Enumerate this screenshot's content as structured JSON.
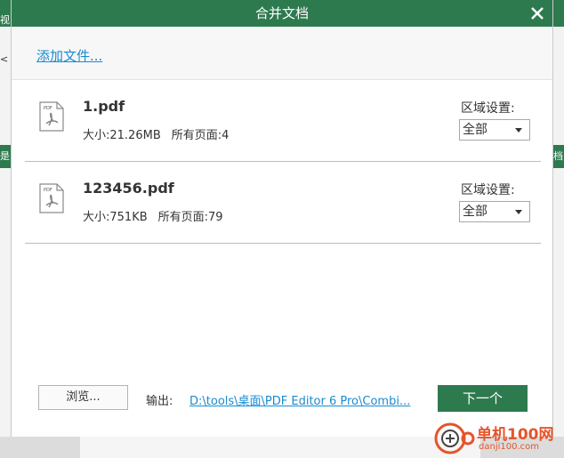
{
  "dialog": {
    "title": "合并文档",
    "add_files_label": "添加文件...",
    "files": [
      {
        "name": "1.pdf",
        "size": "大小:21.26MB",
        "pages": "所有页面:4",
        "region_label": "区域设置:",
        "region_value": "全部",
        "icon": "pdf-file-icon"
      },
      {
        "name": "123456.pdf",
        "size": "大小:751KB",
        "pages": "所有页面:79",
        "region_label": "区域设置:",
        "region_value": "全部",
        "icon": "pdf-file-icon"
      }
    ],
    "browse_label": "浏览...",
    "output_label": "输出:",
    "output_path": "D:\\tools\\桌面\\PDF Editor 6 Pro\\Combi...",
    "next_label": "下一个"
  },
  "background": {
    "left_tab_text": "视",
    "left_glyph": "<",
    "left_label": "是",
    "right_label": "档"
  },
  "watermark": {
    "text": "单机100网",
    "url": "danji100.com"
  },
  "colors": {
    "accent": "#2d7a4f",
    "link": "#1a8bd1",
    "watermark": "#e5542b"
  }
}
